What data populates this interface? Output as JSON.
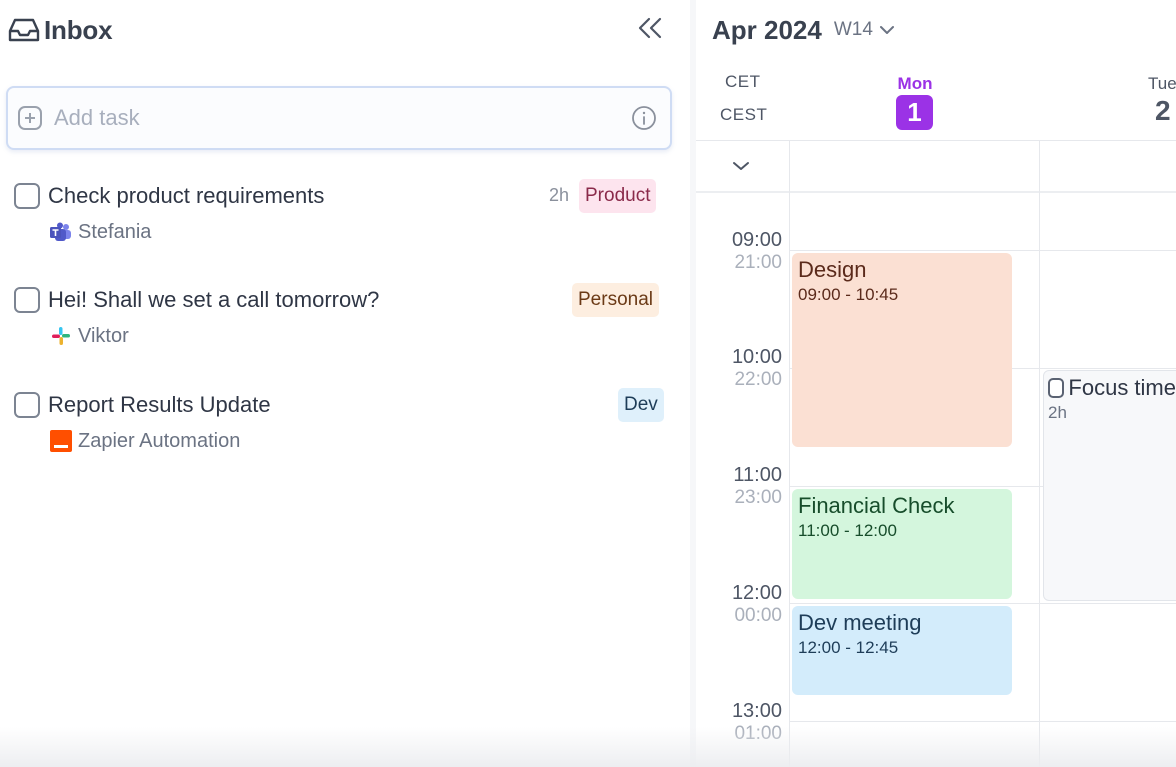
{
  "inbox": {
    "title": "Inbox",
    "add_task_placeholder": "Add task",
    "tasks": [
      {
        "title": "Check product requirements",
        "source": "Stefania",
        "source_icon": "teams-icon",
        "duration": "2h",
        "tag": "Product",
        "tag_bg": "#fde4ee",
        "tag_fg": "#8a2a4a"
      },
      {
        "title": "Hei! Shall we set a call tomorrow?",
        "source": "Viktor",
        "source_icon": "slack-icon",
        "duration": "",
        "tag": "Personal",
        "tag_bg": "#fdeee0",
        "tag_fg": "#6b3a16"
      },
      {
        "title": "Report Results Update",
        "source": "Zapier Automation",
        "source_icon": "zapier-icon",
        "duration": "",
        "tag": "Dev",
        "tag_bg": "#dff0fb",
        "tag_fg": "#1e3d58"
      }
    ]
  },
  "calendar": {
    "month_title": "Apr 2024",
    "week": "W14",
    "timezones": [
      "CET",
      "CEST"
    ],
    "days": [
      {
        "label": "Mon",
        "number": "1",
        "today": true
      },
      {
        "label": "Tue",
        "number": "2",
        "today": false
      }
    ],
    "hours": [
      {
        "primary": "09:00",
        "secondary": "21:00"
      },
      {
        "primary": "10:00",
        "secondary": "22:00"
      },
      {
        "primary": "11:00",
        "secondary": "23:00"
      },
      {
        "primary": "12:00",
        "secondary": "00:00"
      },
      {
        "primary": "13:00",
        "secondary": "01:00"
      }
    ],
    "events": [
      {
        "title": "Design",
        "time": "09:00 - 10:45"
      },
      {
        "title": "Financial Check",
        "time": "11:00 - 12:00"
      },
      {
        "title": "Dev meeting",
        "time": "12:00 - 12:45"
      },
      {
        "title": "Focus time",
        "time": "2h"
      }
    ],
    "accent": "#9b32e6"
  }
}
